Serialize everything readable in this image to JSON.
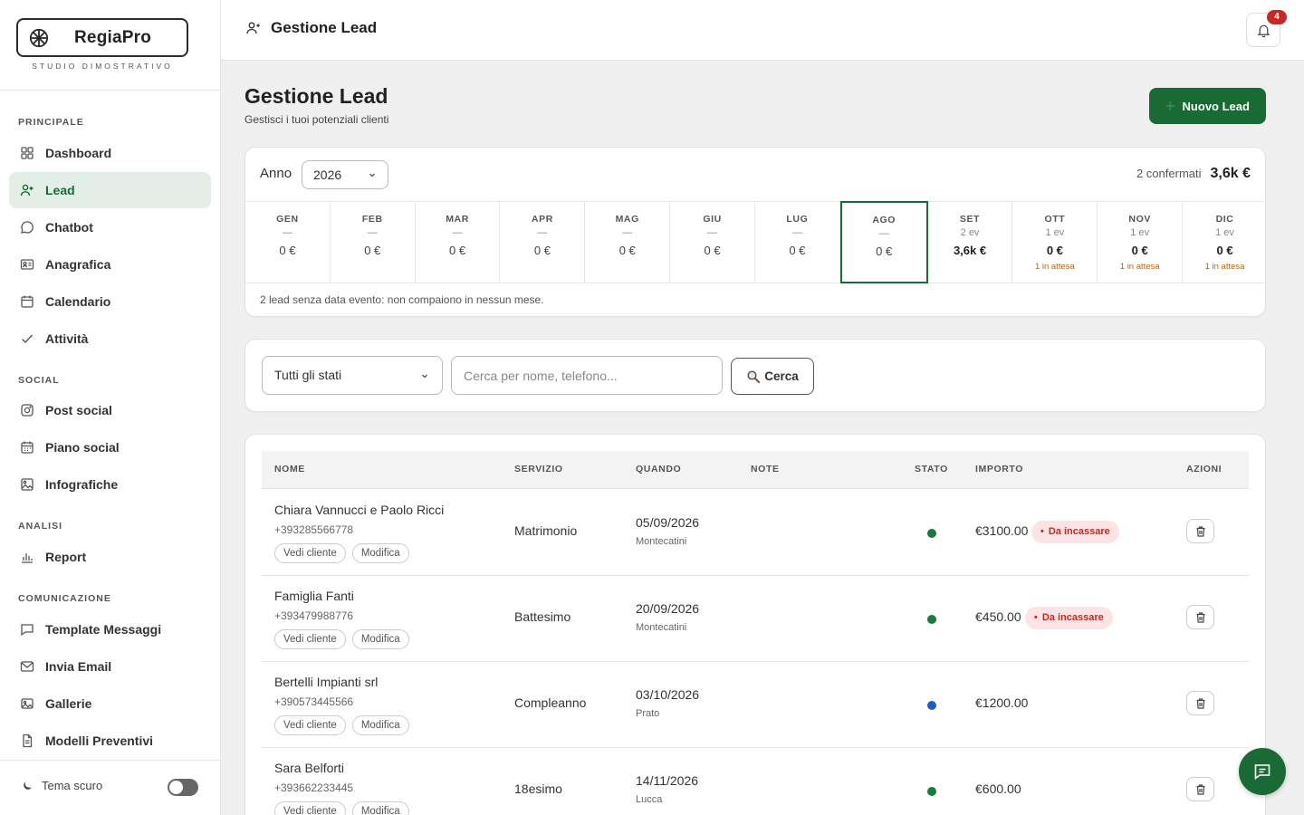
{
  "brand": {
    "name": "RegiaPro",
    "subtitle": "STUDIO DIMOSTRATIVO"
  },
  "sidebar": {
    "sections": {
      "principale": "PRINCIPALE",
      "social": "SOCIAL",
      "analisi": "ANALISI",
      "comunicazione": "COMUNICAZIONE"
    },
    "items": {
      "dashboard": "Dashboard",
      "lead": "Lead",
      "chatbot": "Chatbot",
      "anagrafica": "Anagrafica",
      "calendario": "Calendario",
      "attivita": "Attività",
      "post_social": "Post social",
      "piano_social": "Piano social",
      "infografiche": "Infografiche",
      "report": "Report",
      "template_messaggi": "Template Messaggi",
      "invia_email": "Invia Email",
      "gallerie": "Gallerie",
      "modelli_preventivi": "Modelli Preventivi"
    },
    "active": "lead",
    "theme_label": "Tema scuro",
    "theme_dark": false
  },
  "topbar": {
    "title": "Gestione Lead",
    "notifications": "4"
  },
  "page": {
    "title": "Gestione Lead",
    "subtitle": "Gestisci i tuoi potenziali clienti",
    "new_button": "Nuovo Lead"
  },
  "year_panel": {
    "anno_label": "Anno",
    "year": "2026",
    "confirmed_label": "2 confermati",
    "confirmed_value": "3,6k €",
    "months": [
      {
        "name": "GEN",
        "events": "—",
        "amount": "0 €",
        "pending": ""
      },
      {
        "name": "FEB",
        "events": "—",
        "amount": "0 €",
        "pending": ""
      },
      {
        "name": "MAR",
        "events": "—",
        "amount": "0 €",
        "pending": ""
      },
      {
        "name": "APR",
        "events": "—",
        "amount": "0 €",
        "pending": ""
      },
      {
        "name": "MAG",
        "events": "—",
        "amount": "0 €",
        "pending": ""
      },
      {
        "name": "GIU",
        "events": "—",
        "amount": "0 €",
        "pending": ""
      },
      {
        "name": "LUG",
        "events": "—",
        "amount": "0 €",
        "pending": ""
      },
      {
        "name": "AGO",
        "events": "—",
        "amount": "0 €",
        "pending": ""
      },
      {
        "name": "SET",
        "events": "2 ev",
        "amount": "3,6k €",
        "pending": ""
      },
      {
        "name": "OTT",
        "events": "1 ev",
        "amount": "0 €",
        "pending": "1 in attesa"
      },
      {
        "name": "NOV",
        "events": "1 ev",
        "amount": "0 €",
        "pending": "1 in attesa"
      },
      {
        "name": "DIC",
        "events": "1 ev",
        "amount": "0 €",
        "pending": "1 in attesa"
      }
    ],
    "selected_month": "AGO",
    "note": "2 lead senza data evento: non compaiono in nessun mese."
  },
  "filters": {
    "status_value": "Tutti gli stati",
    "search_placeholder": "Cerca per nome, telefono...",
    "search_button": "Cerca"
  },
  "table": {
    "headers": {
      "nome": "NOME",
      "servizio": "SERVIZIO",
      "quando": "QUANDO",
      "note": "NOTE",
      "stato": "STATO",
      "importo": "IMPORTO",
      "azioni": "AZIONI"
    },
    "view_label": "Vedi cliente",
    "edit_label": "Modifica",
    "rows": [
      {
        "name": "Chiara Vannucci e Paolo Ricci",
        "phone": "+393285566778",
        "service": "Matrimonio",
        "date": "05/09/2026",
        "place": "Montecatini",
        "status_color": "#1a7a3c",
        "amount": "€3100.00",
        "badge": "Da incassare"
      },
      {
        "name": "Famiglia Fanti",
        "phone": "+393479988776",
        "service": "Battesimo",
        "date": "20/09/2026",
        "place": "Montecatini",
        "status_color": "#1a7a3c",
        "amount": "€450.00",
        "badge": "Da incassare"
      },
      {
        "name": "Bertelli Impianti srl",
        "phone": "+390573445566",
        "service": "Compleanno",
        "date": "03/10/2026",
        "place": "Prato",
        "status_color": "#1f5fc4",
        "amount": "€1200.00",
        "badge": ""
      },
      {
        "name": "Sara Belforti",
        "phone": "+393662233445",
        "service": "18esimo",
        "date": "14/11/2026",
        "place": "Lucca",
        "status_color": "#1a7a3c",
        "amount": "€600.00",
        "badge": ""
      }
    ]
  },
  "colors": {
    "accent": "#1a6a36",
    "accent_light": "#e3efe6",
    "danger": "#c62828",
    "pending": "#b5651d"
  }
}
